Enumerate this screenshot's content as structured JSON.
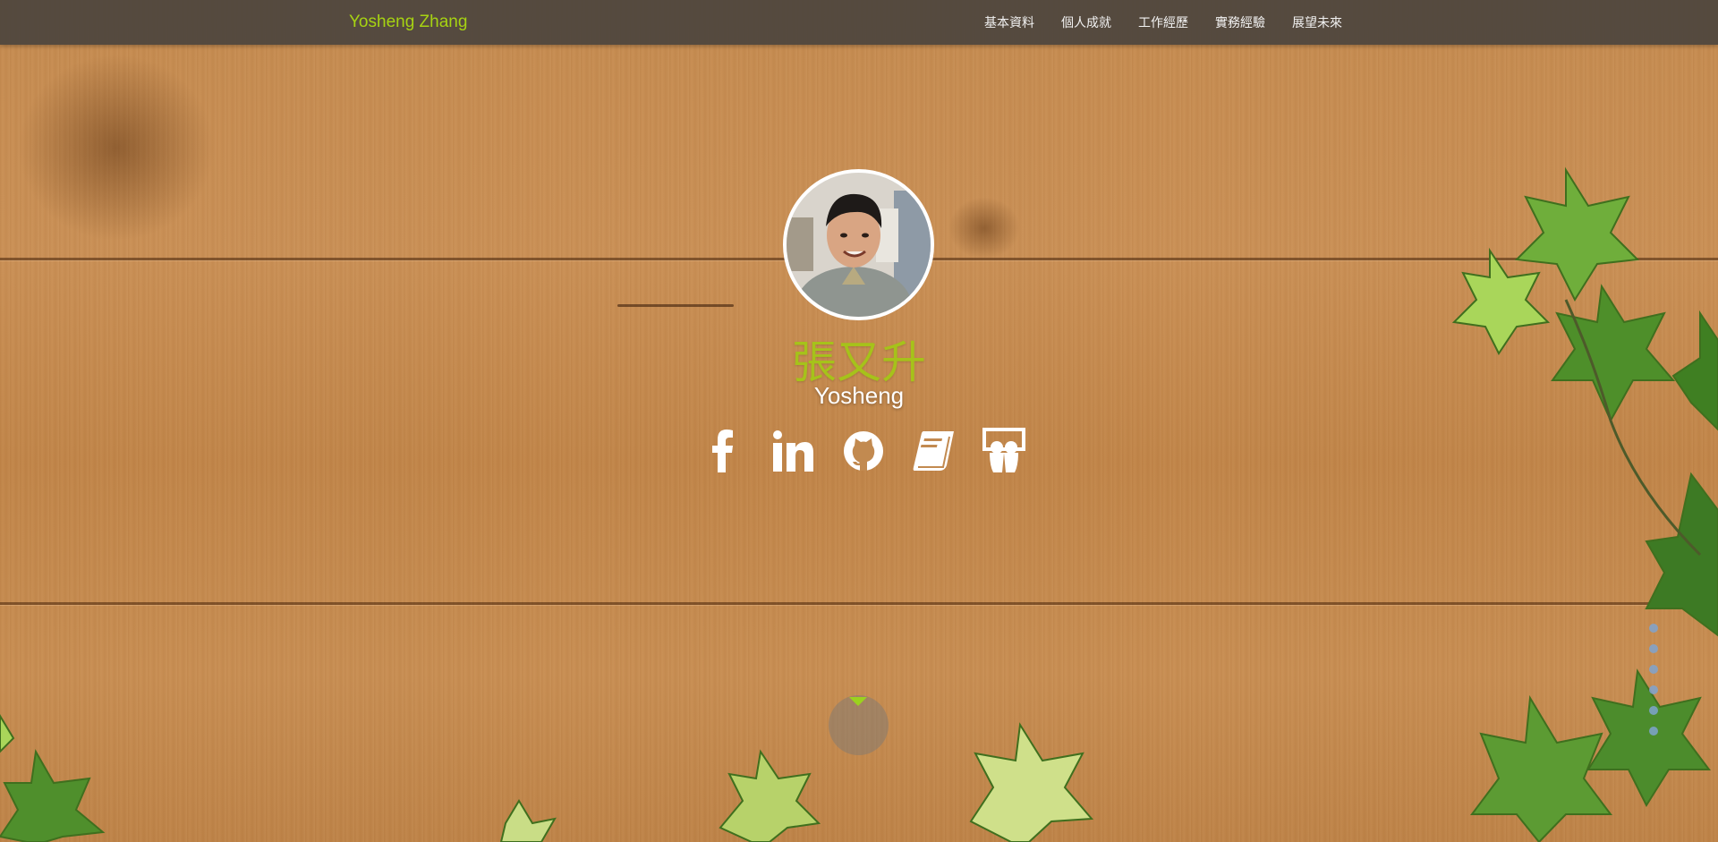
{
  "brand": "Yosheng Zhang",
  "nav": [
    {
      "label": "基本資料"
    },
    {
      "label": "個人成就"
    },
    {
      "label": "工作經歷"
    },
    {
      "label": "實務經驗"
    },
    {
      "label": "展望未來"
    }
  ],
  "hero": {
    "name_zh": "張又升",
    "name_en": "Yosheng"
  },
  "socials": [
    {
      "icon": "facebook-icon"
    },
    {
      "icon": "linkedin-icon"
    },
    {
      "icon": "github-icon"
    },
    {
      "icon": "book-icon"
    },
    {
      "icon": "slideshare-icon"
    }
  ],
  "page_dots": 6,
  "colors": {
    "brand_green": "#a6d312",
    "name_green": "#a6c21a",
    "dot_blue": "#7fa3cf",
    "navbar_bg": "#46413c"
  }
}
